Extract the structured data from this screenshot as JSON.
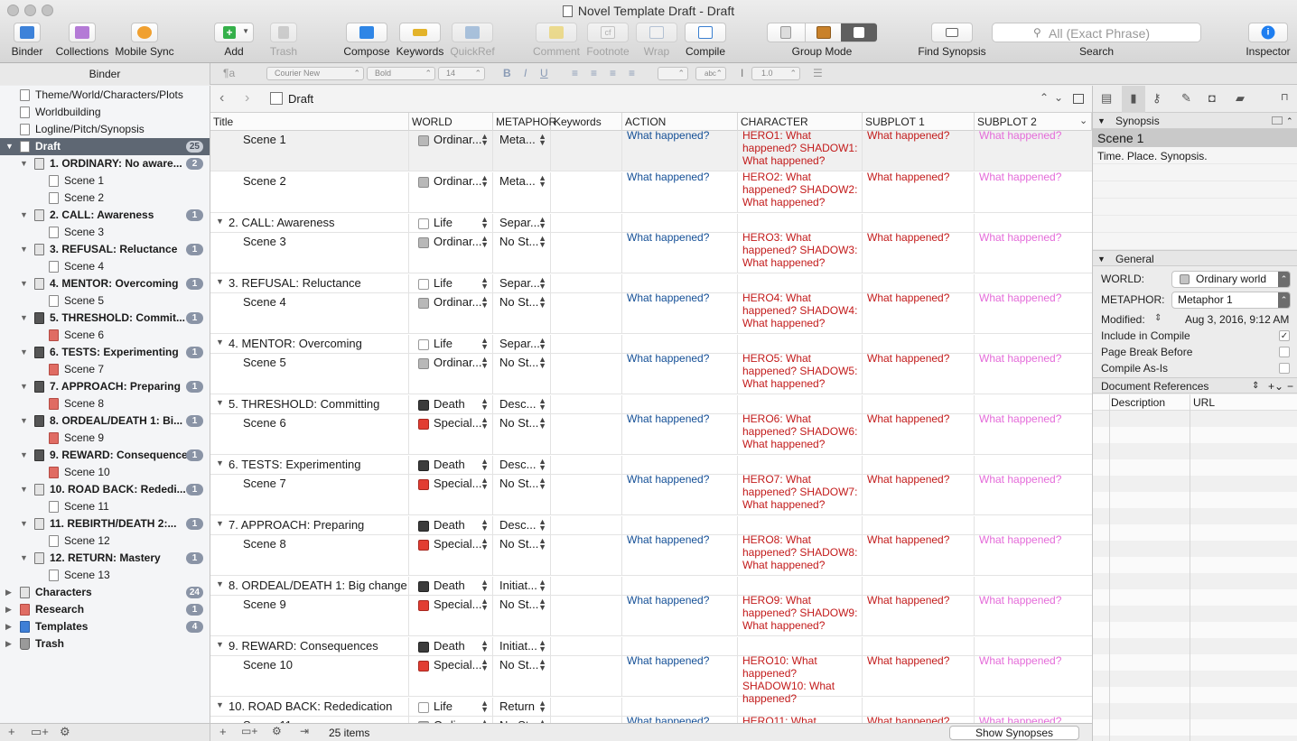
{
  "window": {
    "title": "Novel Template Draft - Draft"
  },
  "toolbar": {
    "binder": "Binder",
    "collections": "Collections",
    "mobile_sync": "Mobile Sync",
    "add": "Add",
    "trash": "Trash",
    "compose": "Compose",
    "keywords": "Keywords",
    "quickref": "QuickRef",
    "comment": "Comment",
    "footnote": "Footnote",
    "wrap": "Wrap",
    "compile": "Compile",
    "group_mode": "Group Mode",
    "find_synopsis": "Find Synopsis",
    "search": "Search",
    "search_placeholder": "All (Exact Phrase)",
    "inspector": "Inspector",
    "footnote_glyph": "cf"
  },
  "format": {
    "binder_header": "Binder",
    "font": "Courier New",
    "weight": "Bold",
    "size": "14",
    "line_spacing": "1.0",
    "para_style": "¶a",
    "bold": "B",
    "italic": "I",
    "underline": "U",
    "highlight_label": "abc"
  },
  "binder": {
    "items": [
      {
        "label": "Theme/World/Characters/Plots"
      },
      {
        "label": "Worldbuilding"
      },
      {
        "label": "Logline/Pitch/Synopsis"
      },
      {
        "label": "Draft",
        "badge": "25"
      },
      {
        "label": "1. ORDINARY: No aware...",
        "badge": "2"
      },
      {
        "label": "Scene 1"
      },
      {
        "label": "Scene 2"
      },
      {
        "label": "2. CALL: Awareness",
        "badge": "1"
      },
      {
        "label": "Scene 3"
      },
      {
        "label": "3. REFUSAL: Reluctance",
        "badge": "1"
      },
      {
        "label": "Scene 4"
      },
      {
        "label": "4. MENTOR: Overcoming",
        "badge": "1"
      },
      {
        "label": "Scene 5"
      },
      {
        "label": "5. THRESHOLD: Commit...",
        "badge": "1"
      },
      {
        "label": "Scene 6"
      },
      {
        "label": "6. TESTS: Experimenting",
        "badge": "1"
      },
      {
        "label": "Scene 7"
      },
      {
        "label": "7. APPROACH: Preparing",
        "badge": "1"
      },
      {
        "label": "Scene 8"
      },
      {
        "label": "8. ORDEAL/DEATH 1: Bi...",
        "badge": "1"
      },
      {
        "label": "Scene 9"
      },
      {
        "label": "9. REWARD: Consequences",
        "badge": "1"
      },
      {
        "label": "Scene 10"
      },
      {
        "label": "10. ROAD BACK: Rededi...",
        "badge": "1"
      },
      {
        "label": "Scene 11"
      },
      {
        "label": "11. REBIRTH/DEATH 2:...",
        "badge": "1"
      },
      {
        "label": "Scene 12"
      },
      {
        "label": "12. RETURN: Mastery",
        "badge": "1"
      },
      {
        "label": "Scene 13"
      },
      {
        "label": "Characters",
        "badge": "24"
      },
      {
        "label": "Research",
        "badge": "1"
      },
      {
        "label": "Templates",
        "badge": "4"
      },
      {
        "label": "Trash"
      }
    ]
  },
  "editor": {
    "header_title": "Draft",
    "columns": [
      "Title",
      "WORLD",
      "METAPHOR",
      "Keywords",
      "ACTION",
      "CHARACTER",
      "SUBPLOT 1",
      "SUBPLOT 2"
    ],
    "rows": [
      {
        "title": "Scene 1",
        "world": "Ordinar...",
        "meta": "Meta...",
        "action": "What happened?",
        "character": "HERO1: What happened? SHADOW1: What happened?",
        "sub1": "What happened?",
        "sub2": "What happened?"
      },
      {
        "title": "Scene 2",
        "world": "Ordinar...",
        "meta": "Meta...",
        "action": "What happened?",
        "character": "HERO2: What happened? SHADOW2: What happened?",
        "sub1": "What happened?",
        "sub2": "What happened?"
      },
      {
        "title": "2. CALL: Awareness",
        "world": "Life",
        "meta": "Separ..."
      },
      {
        "title": "Scene 3",
        "world": "Ordinar...",
        "meta": "No St...",
        "action": "What happened?",
        "character": "HERO3: What happened? SHADOW3: What happened?",
        "sub1": "What happened?",
        "sub2": "What happened?"
      },
      {
        "title": "3. REFUSAL: Reluctance",
        "world": "Life",
        "meta": "Separ..."
      },
      {
        "title": "Scene 4",
        "world": "Ordinar...",
        "meta": "No St...",
        "action": "What happened?",
        "character": "HERO4: What happened? SHADOW4: What happened?",
        "sub1": "What happened?",
        "sub2": "What happened?"
      },
      {
        "title": "4. MENTOR: Overcoming",
        "world": "Life",
        "meta": "Separ..."
      },
      {
        "title": "Scene 5",
        "world": "Ordinar...",
        "meta": "No St...",
        "action": "What happened?",
        "character": "HERO5: What happened? SHADOW5: What happened?",
        "sub1": "What happened?",
        "sub2": "What happened?"
      },
      {
        "title": "5. THRESHOLD: Committing",
        "world": "Death",
        "meta": "Desc..."
      },
      {
        "title": "Scene 6",
        "world": "Special...",
        "meta": "No St...",
        "action": "What happened?",
        "character": "HERO6: What happened? SHADOW6: What happened?",
        "sub1": "What happened?",
        "sub2": "What happened?"
      },
      {
        "title": "6. TESTS: Experimenting",
        "world": "Death",
        "meta": "Desc..."
      },
      {
        "title": "Scene 7",
        "world": "Special...",
        "meta": "No St...",
        "action": "What happened?",
        "character": "HERO7: What happened? SHADOW7: What happened?",
        "sub1": "What happened?",
        "sub2": "What happened?"
      },
      {
        "title": "7. APPROACH: Preparing",
        "world": "Death",
        "meta": "Desc..."
      },
      {
        "title": "Scene 8",
        "world": "Special...",
        "meta": "No St...",
        "action": "What happened?",
        "character": "HERO8: What happened? SHADOW8: What happened?",
        "sub1": "What happened?",
        "sub2": "What happened?"
      },
      {
        "title": "8. ORDEAL/DEATH 1: Big change",
        "world": "Death",
        "meta": "Initiat..."
      },
      {
        "title": "Scene 9",
        "world": "Special...",
        "meta": "No St...",
        "action": "What happened?",
        "character": "HERO9: What happened? SHADOW9: What happened?",
        "sub1": "What happened?",
        "sub2": "What happened?"
      },
      {
        "title": "9. REWARD: Consequences",
        "world": "Death",
        "meta": "Initiat..."
      },
      {
        "title": "Scene 10",
        "world": "Special...",
        "meta": "No St...",
        "action": "What happened?",
        "character": "HERO10: What happened? SHADOW10: What happened?",
        "sub1": "What happened?",
        "sub2": "What happened?"
      },
      {
        "title": "10. ROAD BACK: Rededication",
        "world": "Life",
        "meta": "Return"
      },
      {
        "title": "Scene 11",
        "world": "Ordinar...",
        "meta": "No St...",
        "action": "What happened?",
        "character": "HERO11: What",
        "sub1": "What happened?",
        "sub2": "What happened?"
      }
    ],
    "footer": {
      "count": "25 items",
      "show_synopses": "Show Synopses"
    }
  },
  "inspector": {
    "synopsis_header": "Synopsis",
    "doc_title": "Scene 1",
    "synopsis_text": "Time. Place. Synopsis.",
    "general_header": "General",
    "world_label": "WORLD:",
    "world_value": "Ordinary world",
    "metaphor_label": "METAPHOR:",
    "metaphor_value": "Metaphor 1",
    "modified_label": "Modified:",
    "modified_value": "Aug 3, 2016, 9:12 AM",
    "include_compile": "Include in Compile",
    "page_break": "Page Break Before",
    "compile_as_is": "Compile As-Is",
    "doc_refs": "Document References",
    "col_desc": "Description",
    "col_url": "URL",
    "check_mark": "✓"
  }
}
